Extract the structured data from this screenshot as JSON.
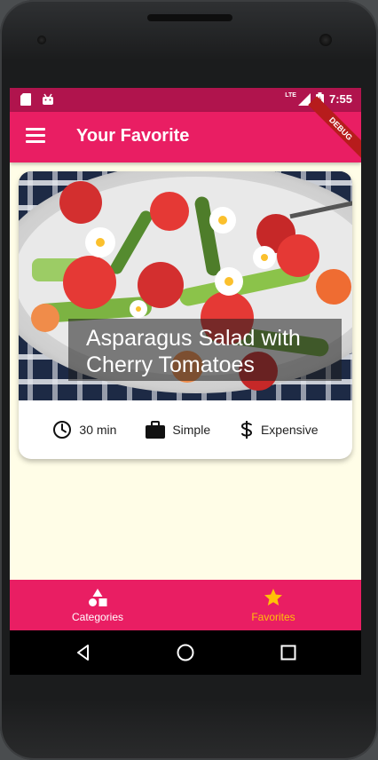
{
  "status_bar": {
    "time": "7:55",
    "network": "LTE",
    "icons": [
      "sd-card-icon",
      "android-icon",
      "signal-icon",
      "battery-icon"
    ],
    "debug_label": "DEBUG"
  },
  "app_bar": {
    "title": "Your Favorite",
    "menu_icon": "menu-icon",
    "color": "#e91e63"
  },
  "meal": {
    "title": "Asparagus Salad with Cherry Tomatoes",
    "duration": "30 min",
    "complexity": "Simple",
    "affordability": "Expensive",
    "duration_icon": "clock-icon",
    "complexity_icon": "briefcase-icon",
    "affordability_icon": "dollar-icon"
  },
  "bottom_nav": {
    "items": [
      {
        "label": "Categories",
        "icon": "category-icon",
        "selected": false
      },
      {
        "label": "Favorites",
        "icon": "star-icon",
        "selected": true
      }
    ],
    "selected_color": "#ffc107"
  },
  "system_nav": {
    "buttons": [
      "back-icon",
      "home-icon",
      "recents-icon"
    ]
  }
}
